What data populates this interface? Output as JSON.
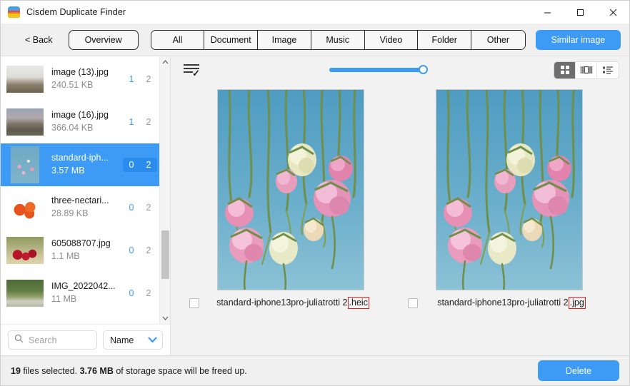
{
  "window": {
    "title": "Cisdem Duplicate Finder",
    "app_icon": "cisdem-logo-icon",
    "minimize": "minimize-icon",
    "maximize": "maximize-icon",
    "close": "close-icon"
  },
  "toolbar": {
    "back_label": "< Back",
    "overview_label": "Overview",
    "tabs": [
      {
        "label": "All"
      },
      {
        "label": "Document"
      },
      {
        "label": "Image"
      },
      {
        "label": "Music"
      },
      {
        "label": "Video"
      },
      {
        "label": "Folder"
      },
      {
        "label": "Other"
      }
    ],
    "similar_image_label": "Similar image",
    "accent_color": "#3d9bf5"
  },
  "sidebar": {
    "files": [
      {
        "name": "image (13).jpg",
        "size": "240.51 KB",
        "left_count": "1",
        "right_count": "2",
        "selected": false,
        "thumb": "mountain-lake-landscape"
      },
      {
        "name": "image (16).jpg",
        "size": "366.04 KB",
        "left_count": "1",
        "right_count": "2",
        "selected": false,
        "thumb": "hazy-valley-landscape"
      },
      {
        "name": "standard-iph...",
        "size": "3.57 MB",
        "left_count": "0",
        "right_count": "2",
        "selected": true,
        "thumb": "hanging-roses"
      },
      {
        "name": "three-nectari...",
        "size": "28.89 KB",
        "left_count": "0",
        "right_count": "2",
        "selected": false,
        "thumb": "nectarines"
      },
      {
        "name": "605088707.jpg",
        "size": "1.1 MB",
        "left_count": "0",
        "right_count": "2",
        "selected": false,
        "thumb": "cherries"
      },
      {
        "name": "IMG_2022042...",
        "size": "11 MB",
        "left_count": "0",
        "right_count": "2",
        "selected": false,
        "thumb": "garden-path"
      }
    ],
    "scroll_up_icon": "chevron-up-icon",
    "scroll_down_icon": "chevron-down-icon",
    "search": {
      "placeholder": "Search",
      "value": "",
      "icon": "search-icon"
    },
    "sort": {
      "selected": "Name",
      "icon": "chevron-down-icon"
    }
  },
  "main": {
    "select_all_icon": "list-check-icon",
    "zoom_slider": {
      "value": 100,
      "min": 0,
      "max": 100
    },
    "view_modes": [
      {
        "name": "grid-view",
        "icon": "grid-icon",
        "active": true
      },
      {
        "name": "compare-view",
        "icon": "compare-icon",
        "active": false
      },
      {
        "name": "list-view",
        "icon": "list-icon",
        "active": false
      }
    ],
    "items": [
      {
        "name_base": "standard-iphone13pro-juliatrotti 2",
        "extension": ".heic",
        "checked": false,
        "image": "hanging-roses-photo"
      },
      {
        "name_base": "standard-iphone13pro-juliatrotti 2",
        "extension": ".jpg",
        "checked": false,
        "image": "hanging-roses-photo"
      }
    ],
    "highlight_color": "#e02020"
  },
  "statusbar": {
    "files_count": "19",
    "files_label": "files selected.",
    "freed_size": "3.76 MB",
    "freed_label": "of storage space will be freed up.",
    "delete_label": "Delete"
  }
}
